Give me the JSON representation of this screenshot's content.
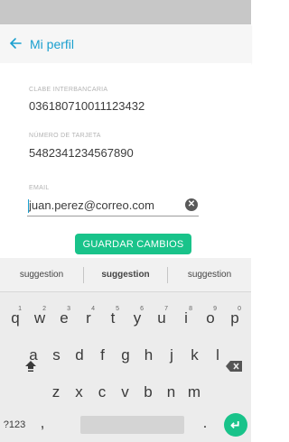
{
  "app_bar": {
    "title": "Mi perfil",
    "back_icon": "arrow-left-icon",
    "accent": "#1a9fcf"
  },
  "fields": {
    "clabe": {
      "label": "CLABE INTERBANCARIA",
      "value": "036180710011123432"
    },
    "card": {
      "label": "NÚMERO DE TARJETA",
      "value": "5482341234567890"
    },
    "email": {
      "label": "EMAIL",
      "value": "juan.perez@correo.com"
    }
  },
  "save_button": {
    "label": "GUARDAR CAMBIOS",
    "color": "#19c38a"
  },
  "keyboard": {
    "suggestions": [
      "suggestion",
      "suggestion",
      "suggestion"
    ],
    "row1": [
      {
        "k": "q",
        "h": "1"
      },
      {
        "k": "w",
        "h": "2"
      },
      {
        "k": "e",
        "h": "3"
      },
      {
        "k": "r",
        "h": "4"
      },
      {
        "k": "t",
        "h": "5"
      },
      {
        "k": "y",
        "h": "6"
      },
      {
        "k": "u",
        "h": "7"
      },
      {
        "k": "i",
        "h": "8"
      },
      {
        "k": "o",
        "h": "9"
      },
      {
        "k": "p",
        "h": "0"
      }
    ],
    "row2": [
      "a",
      "s",
      "d",
      "f",
      "g",
      "h",
      "j",
      "k",
      "l"
    ],
    "row3": [
      "z",
      "x",
      "c",
      "v",
      "b",
      "n",
      "m"
    ],
    "symbols_label": "?123",
    "comma": ",",
    "period": ".",
    "shift_icon": "shift-icon",
    "backspace_icon": "backspace-icon",
    "enter_icon": "enter-icon"
  }
}
